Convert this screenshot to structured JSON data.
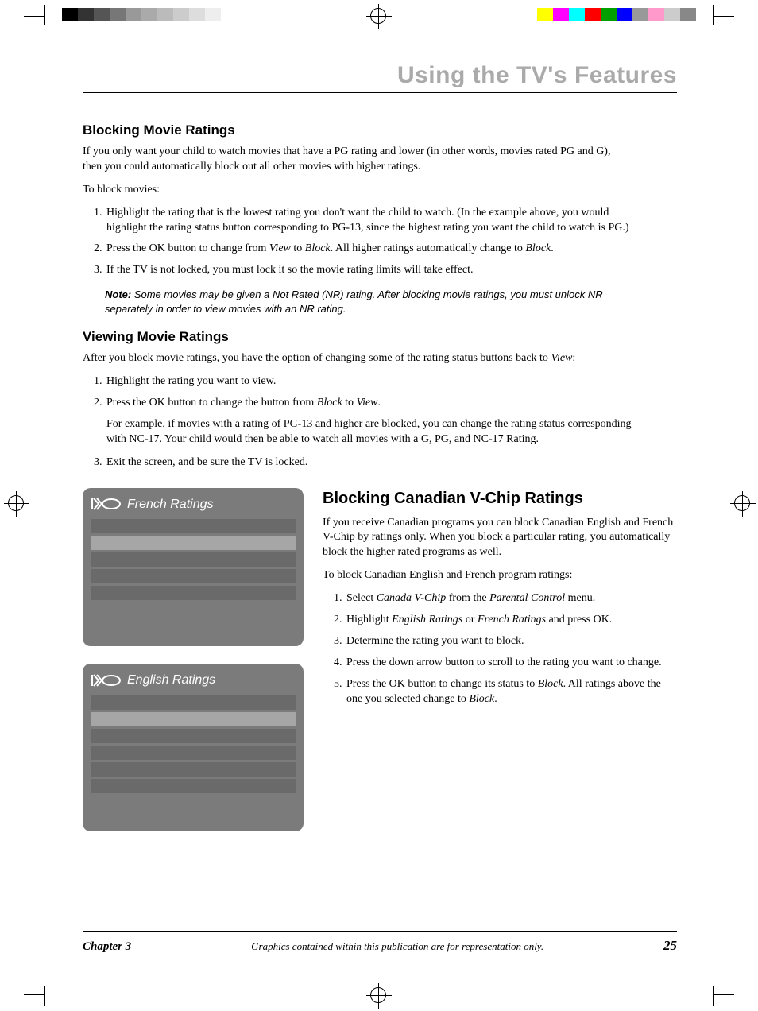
{
  "header": {
    "title": "Using the TV's Features"
  },
  "section1": {
    "heading": "Blocking Movie Ratings",
    "p1": "If you only want your child to watch movies that have a PG rating and lower (in other words, movies rated PG and G), then you could automatically block out all other movies with higher ratings.",
    "p2": "To block movies:",
    "li1": "Highlight the rating that is the lowest rating you don't want the child to watch. (In the example above, you would highlight the rating status button corresponding to PG-13, since the highest rating you want the child to watch is PG.)",
    "li2a": "Press the OK button to change from ",
    "li2b": "View",
    "li2c": " to ",
    "li2d": "Block",
    "li2e": ". All higher ratings automatically change to ",
    "li2f": "Block",
    "li2g": ".",
    "li3": "If the TV is not locked, you must lock it so the movie rating limits will take effect.",
    "note_label": "Note:",
    "note": " Some movies may be given a Not Rated (NR) rating. After blocking movie ratings, you must unlock NR separately in order to view movies with an NR rating."
  },
  "section2": {
    "heading": "Viewing Movie Ratings",
    "p1a": "After you block movie ratings, you have the option of changing some of the rating status buttons back to ",
    "p1b": "View",
    "p1c": ":",
    "li1": "Highlight the rating you want to view.",
    "li2a": "Press the OK button to change the button from ",
    "li2b": "Block",
    "li2c": " to ",
    "li2d": "View",
    "li2e": ".",
    "li2_p": "For example, if movies with a rating of PG-13 and higher are blocked, you can change the rating status corresponding with NC-17. Your child would then be able to watch all movies with a G, PG, and NC-17 Rating.",
    "li3": "Exit the screen, and be sure the TV is locked."
  },
  "panels": {
    "french_title": "French Ratings",
    "english_title": "English Ratings"
  },
  "section3": {
    "heading": "Blocking Canadian V-Chip Ratings",
    "p1": "If you receive Canadian programs you can block Canadian English and French V-Chip by ratings only. When you block a particular rating, you automatically block the higher rated programs as well.",
    "p2": "To block Canadian English and French program ratings:",
    "li1a": "Select ",
    "li1b": "Canada V-Chip",
    "li1c": " from the ",
    "li1d": "Parental Control",
    "li1e": " menu.",
    "li2a": "Highlight ",
    "li2b": "English Ratings",
    "li2c": " or ",
    "li2d": "French Ratings",
    "li2e": " and press OK.",
    "li3": "Determine the rating you want to block.",
    "li4": "Press the down arrow button to scroll to the rating you want to change.",
    "li5a": "Press the OK button to change its status to ",
    "li5b": "Block",
    "li5c": ". All ratings above the one you selected change to ",
    "li5d": "Block",
    "li5e": "."
  },
  "footer": {
    "chapter": "Chapter 3",
    "note": "Graphics contained within this publication are for representation only.",
    "page": "25"
  },
  "colors": {
    "cb_left": [
      "#000",
      "#333",
      "#555",
      "#777",
      "#999",
      "#aaa",
      "#bbb",
      "#ccc",
      "#ddd",
      "#eee"
    ],
    "cb_right": [
      "#ffff00",
      "#ff00ff",
      "#00ffff",
      "#ff0000",
      "#00a000",
      "#0000ff",
      "#999",
      "#ff99cc",
      "#ccc",
      "#888"
    ]
  }
}
